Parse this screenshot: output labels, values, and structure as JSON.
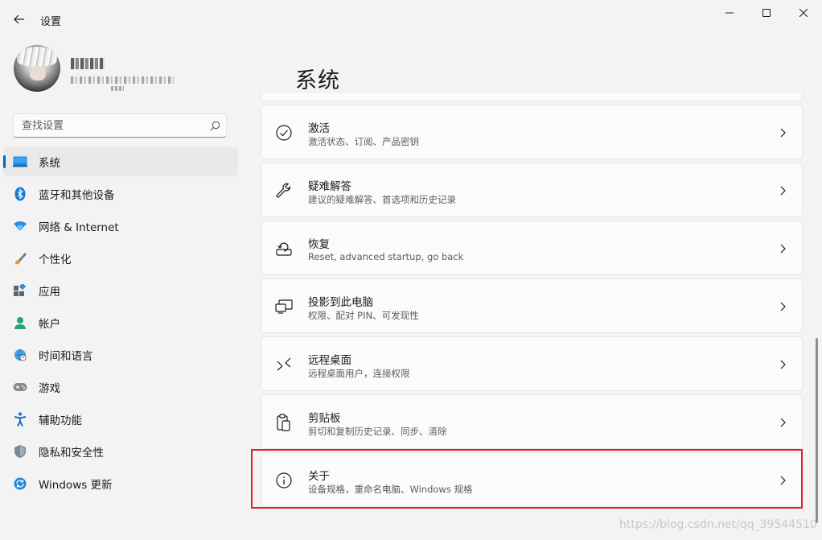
{
  "window": {
    "title": "设置"
  },
  "search": {
    "placeholder": "查找设置"
  },
  "nav": {
    "items": [
      {
        "label": "系统",
        "icon": "system-icon",
        "selected": true
      },
      {
        "label": "蓝牙和其他设备",
        "icon": "bluetooth-icon"
      },
      {
        "label": "网络 & Internet",
        "icon": "wifi-icon"
      },
      {
        "label": "个性化",
        "icon": "brush-icon"
      },
      {
        "label": "应用",
        "icon": "apps-icon"
      },
      {
        "label": "帐户",
        "icon": "account-icon"
      },
      {
        "label": "时间和语言",
        "icon": "globe-clock-icon"
      },
      {
        "label": "游戏",
        "icon": "gamepad-icon"
      },
      {
        "label": "辅助功能",
        "icon": "accessibility-icon"
      },
      {
        "label": "隐私和安全性",
        "icon": "shield-icon"
      },
      {
        "label": "Windows 更新",
        "icon": "update-icon"
      }
    ]
  },
  "main": {
    "title": "系统",
    "cards": [
      {
        "title": "激活",
        "subtitle": "激活状态、订阅、产品密钥",
        "icon": "activation-check-icon"
      },
      {
        "title": "疑难解答",
        "subtitle": "建议的疑难解答、首选项和历史记录",
        "icon": "wrench-icon"
      },
      {
        "title": "恢复",
        "subtitle": "Reset, advanced startup, go back",
        "icon": "recovery-icon"
      },
      {
        "title": "投影到此电脑",
        "subtitle": "权限、配对 PIN、可发现性",
        "icon": "projection-icon"
      },
      {
        "title": "远程桌面",
        "subtitle": "远程桌面用户，连接权限",
        "icon": "remote-desktop-icon"
      },
      {
        "title": "剪贴板",
        "subtitle": "剪切和复制历史记录、同步、清除",
        "icon": "clipboard-icon"
      },
      {
        "title": "关于",
        "subtitle": "设备规格，重命名电脑、Windows 规格",
        "icon": "info-icon"
      }
    ]
  },
  "watermark": "https://blog.csdn.net/qq_39544510",
  "colors": {
    "accent": "#0067c0",
    "highlight": "#e0212b"
  }
}
